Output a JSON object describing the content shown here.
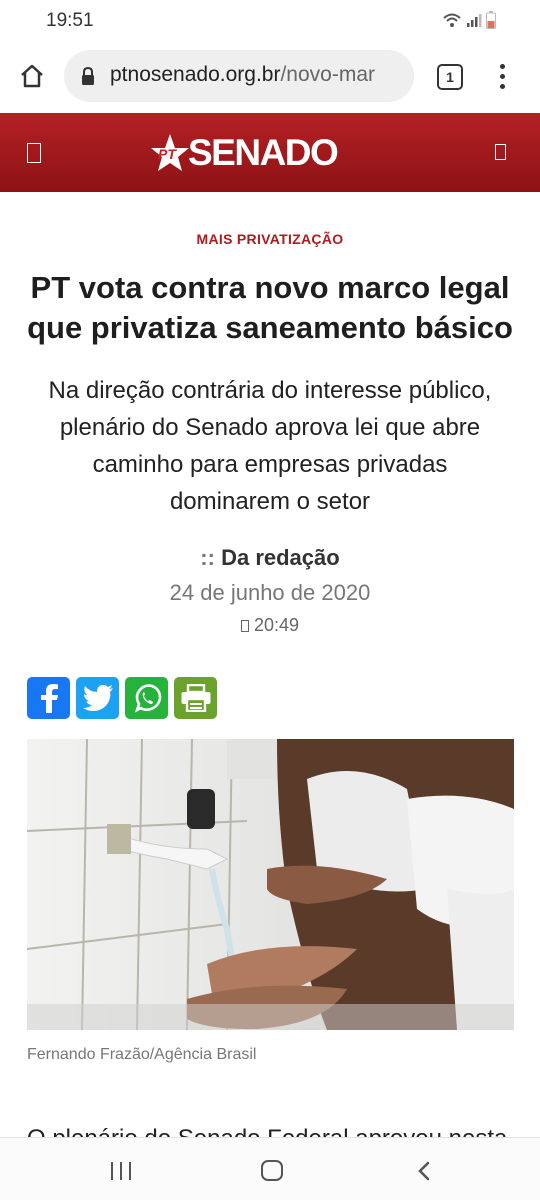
{
  "status_bar": {
    "time": "19:51"
  },
  "browser": {
    "url_domain": "ptnosenado.org.br",
    "url_path": "/novo-mar",
    "tab_count": "1"
  },
  "site": {
    "logo_prefix": "PT",
    "logo_text": "SENADO",
    "brand_color": "#a01a1d"
  },
  "article": {
    "kicker": "MAIS PRIVATIZAÇÃO",
    "headline": "PT vota contra novo marco legal que privatiza saneamento básico",
    "subhead": "Na direção contrária do interesse público, plenário do Senado aprova lei que abre caminho para empresas privadas dominarem o setor",
    "author_prefix": "::",
    "author": "Da redação",
    "date": "24 de junho de 2020",
    "time": "20:49",
    "photo_caption": "Fernando Frazão/Agência Brasil",
    "body_start": "O plenário do Senado Federal aprovou nesta"
  },
  "share": [
    {
      "name": "facebook",
      "icon": "facebook-icon",
      "color": "#1877f2"
    },
    {
      "name": "twitter",
      "icon": "twitter-icon",
      "color": "#1da1f2"
    },
    {
      "name": "whatsapp",
      "icon": "whatsapp-icon",
      "color": "#25b33b"
    },
    {
      "name": "print",
      "icon": "printer-icon",
      "color": "#6aa22c"
    }
  ]
}
